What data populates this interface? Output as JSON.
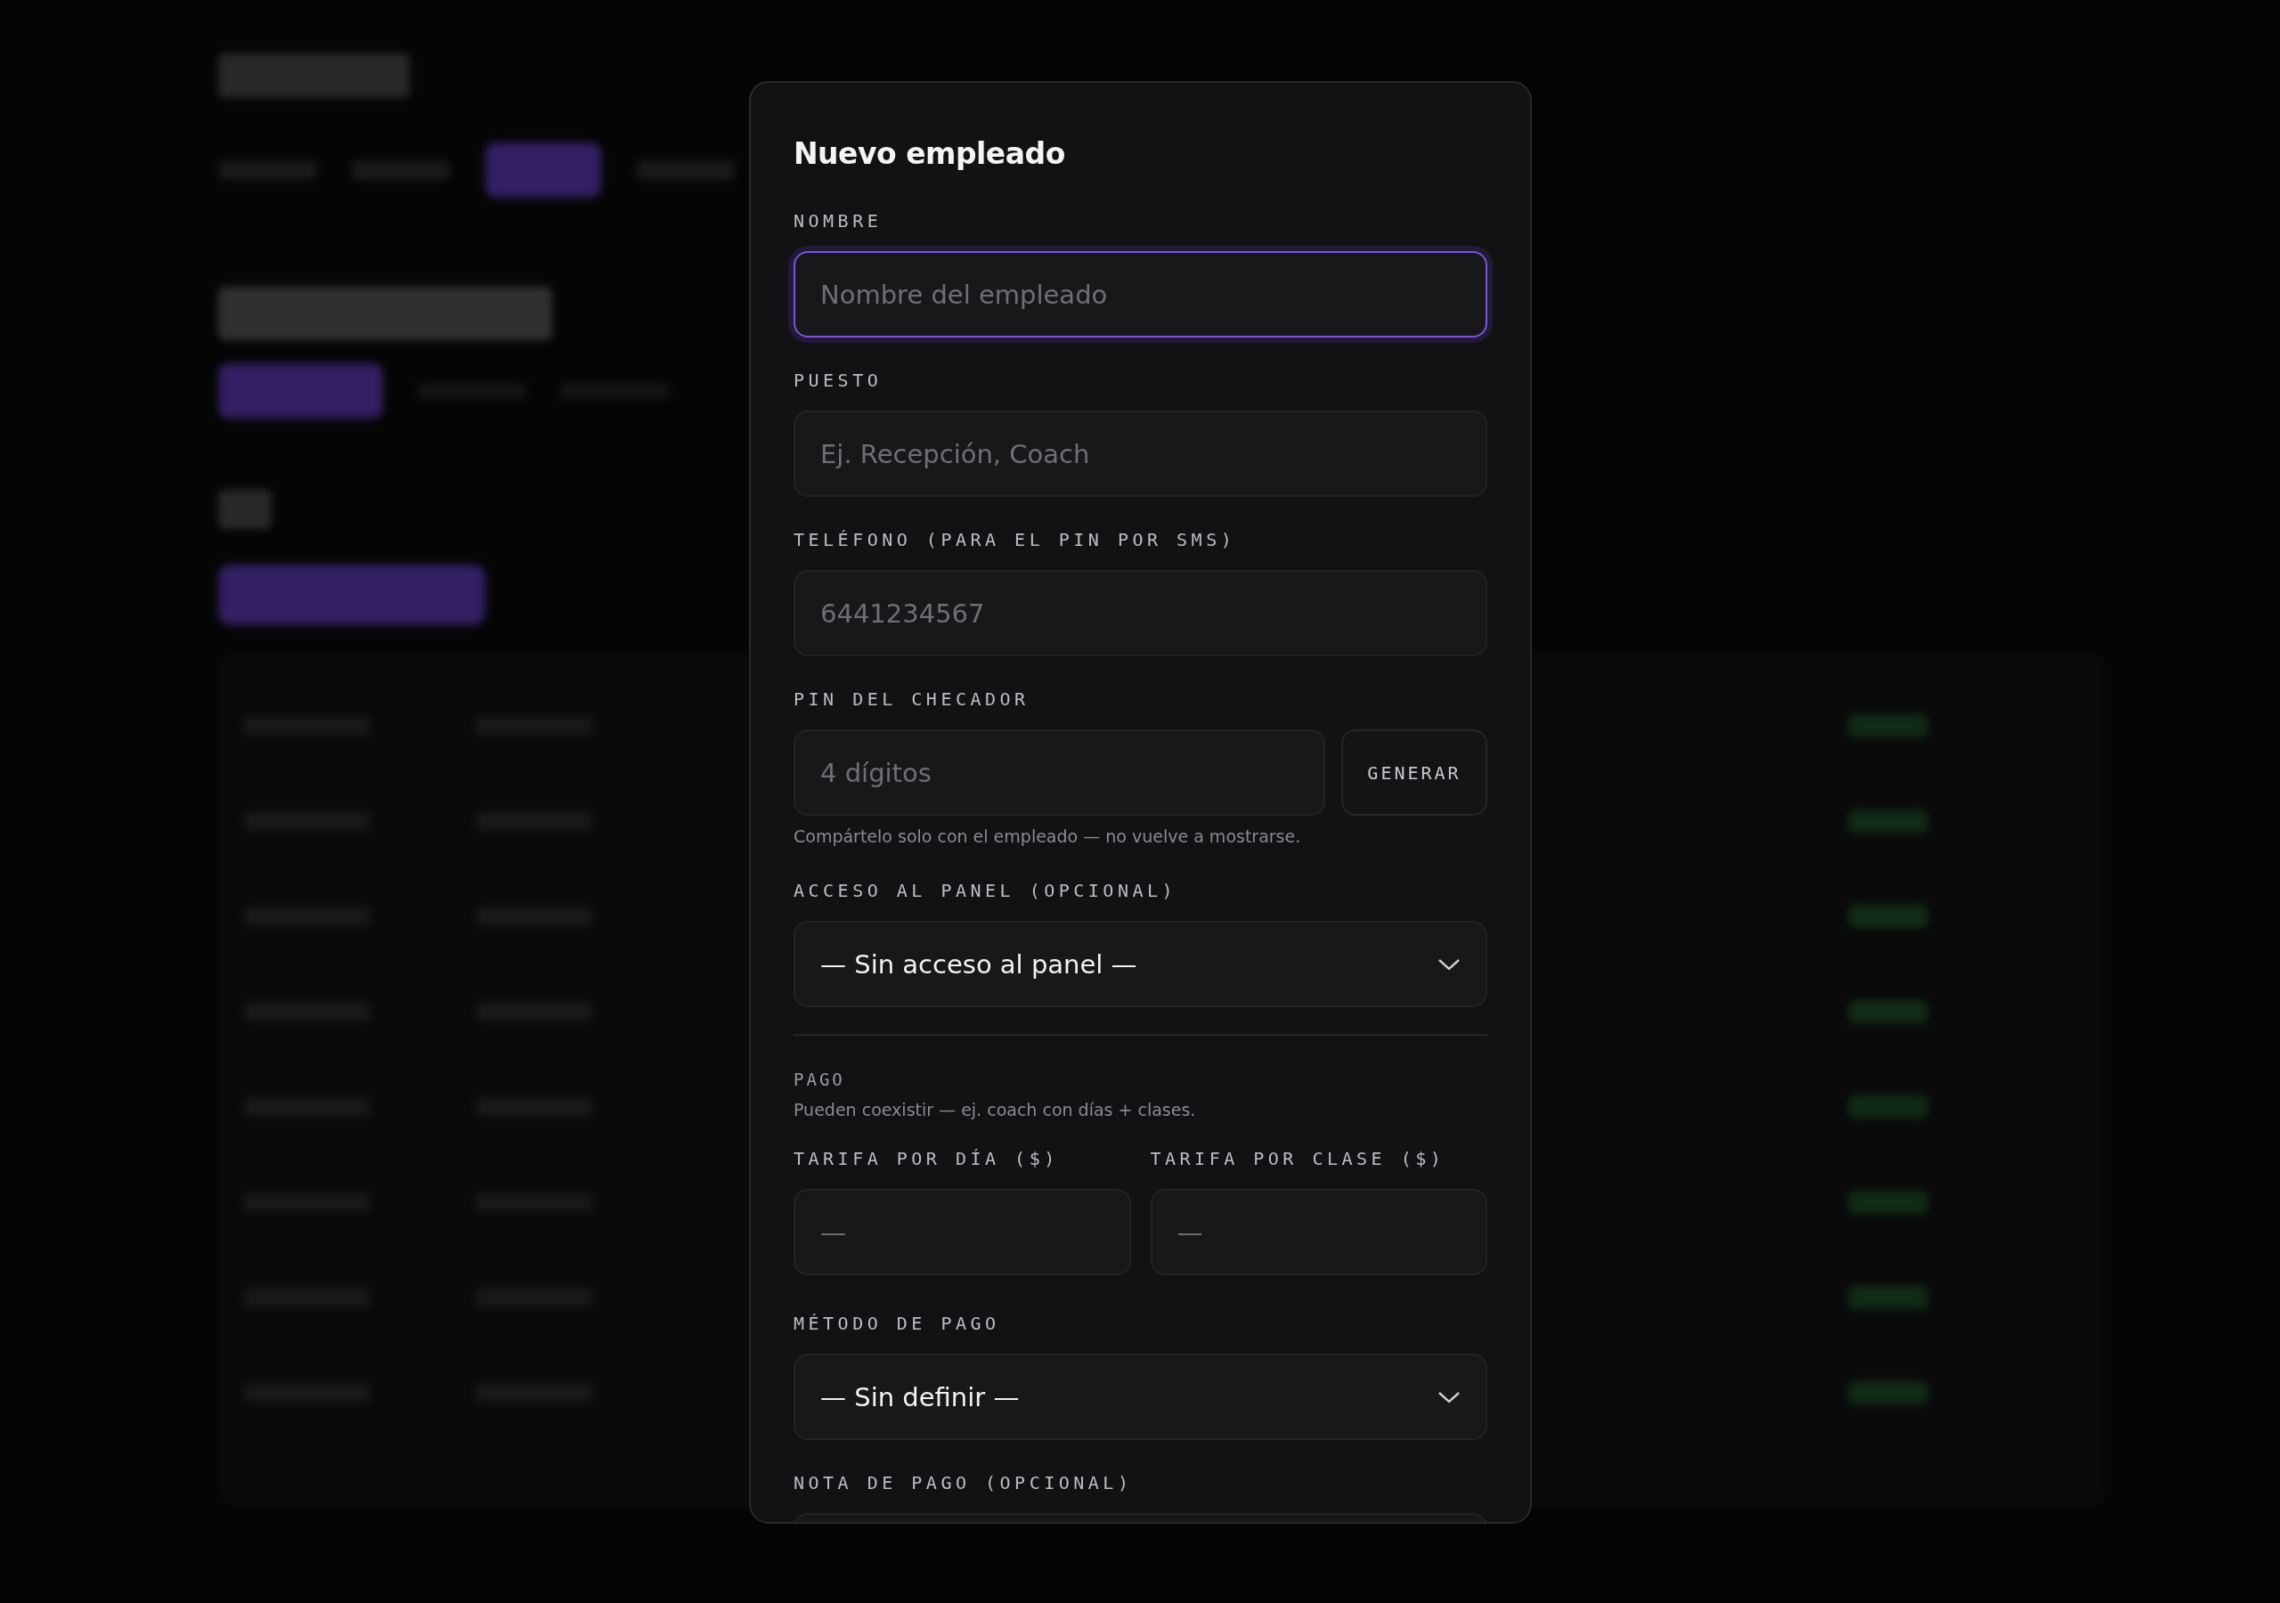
{
  "dialog": {
    "title": "Nuevo empleado",
    "fields": [
      {
        "kind": "input",
        "label": "NOMBRE",
        "placeholder": "Nombre del empleado",
        "focused": true
      },
      {
        "kind": "input",
        "label": "PUESTO",
        "placeholder": "Ej. Recepción, Coach",
        "focused": false
      },
      {
        "kind": "input",
        "label": "TELÉFONO (PARA EL PIN POR SMS)",
        "placeholder": "6441234567",
        "focused": false
      },
      {
        "kind": "pin",
        "label": "PIN DEL CHECADOR",
        "placeholder": "4 dígitos",
        "button": "GENERAR",
        "hint": "Compártelo solo con el empleado — no vuelve a mostrarse."
      },
      {
        "kind": "select",
        "label": "ACCESO AL PANEL (OPCIONAL)",
        "value": "— Sin acceso al panel —"
      },
      {
        "kind": "section",
        "title": "PAGO",
        "hint": "Pueden coexistir — ej. coach con días + clases."
      },
      {
        "kind": "pair",
        "items": [
          {
            "label": "TARIFA POR DÍA ($)",
            "placeholder": "—"
          },
          {
            "label": "TARIFA POR CLASE ($)",
            "placeholder": "—"
          }
        ]
      },
      {
        "kind": "select",
        "label": "MÉTODO DE PAGO",
        "value": "— Sin definir —"
      },
      {
        "kind": "input",
        "label": "NOTA DE PAGO (OPCIONAL)",
        "focused": false
      }
    ]
  }
}
